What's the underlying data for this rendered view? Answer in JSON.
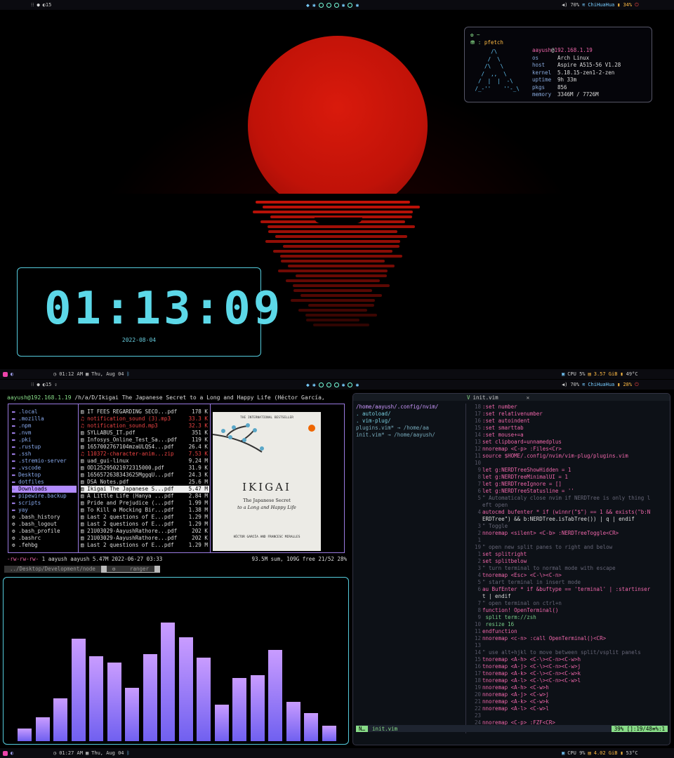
{
  "top_bar": {
    "workspace_count": "15",
    "volume": "70%",
    "wifi": "ChiHuaHua",
    "battery": "34%"
  },
  "pfetch": {
    "cmd_prompt": "~",
    "cmd": "pfetch",
    "user": "aayush",
    "host_ip": "192.168.1.19",
    "art": "      /\\\n     /  \\\n    /\\   \\\n   /  ,,  \\\n  /  |  |  -\\\n /_-''    ''-_\\",
    "rows": [
      {
        "k": "os",
        "v": "Arch Linux"
      },
      {
        "k": "host",
        "v": "Aspire A515-56 V1.28"
      },
      {
        "k": "kernel",
        "v": "5.18.15-zen1-2-zen"
      },
      {
        "k": "uptime",
        "v": "9h 33m"
      },
      {
        "k": "pkgs",
        "v": "856"
      },
      {
        "k": "memory",
        "v": "3346M / 7726M"
      }
    ]
  },
  "clock": {
    "time": "01:13:09",
    "date": "2022-08-04"
  },
  "mid_bar": {
    "time": "01:12 AM",
    "day": "Thu, Aug 04",
    "cpu": "CPU 5%",
    "mem": "3.57 GiB",
    "temp": "49°C",
    "workspace_count": "15",
    "volume": "70%",
    "wifi": "ChiHuaHua",
    "battery": "28%"
  },
  "ranger": {
    "title_user": "aayush@192.168.1.19",
    "title_path": " /h/a/D/Ikigai The Japanese Secret to a Long and Happy Life (Héctor García,",
    "dirs": [
      ".local",
      ".mozilla",
      ".npm",
      ".nvm",
      ".pki",
      ".rustup",
      ".ssh",
      ".stremio-server",
      ".vscode",
      "Desktop",
      "dotfiles",
      "Downloads",
      "pipewire.backup",
      "scripts",
      "yay",
      ".bash_history",
      ".bash_logout",
      ".bash_profile",
      ".bashrc",
      ".fehbg"
    ],
    "files": [
      {
        "n": "IT FEES REGARDING SECO...pdf",
        "s": "178 K",
        "c": ""
      },
      {
        "n": "notification_sound (3).mp3",
        "s": "33.3 K",
        "c": "red"
      },
      {
        "n": "notification_sound.mp3",
        "s": "32.3 K",
        "c": "red"
      },
      {
        "n": "SYLLABUS_IT.pdf",
        "s": "351 K",
        "c": ""
      },
      {
        "n": "Infosys_Online_Test_Sa...pdf",
        "s": "119 K",
        "c": ""
      },
      {
        "n": "1657002767104mzaULQS4...pdf",
        "s": "26.4 K",
        "c": ""
      },
      {
        "n": "110372-character-anim...zip",
        "s": "7.53 K",
        "c": "red"
      },
      {
        "n": "uad_gui-linux",
        "s": "9.24 M",
        "c": ""
      },
      {
        "n": "OD125295021972315000.pdf",
        "s": "31.9 K",
        "c": ""
      },
      {
        "n": "1656572638343625MggqU...pdf",
        "s": "24.3 K",
        "c": ""
      },
      {
        "n": "DSA Notes.pdf",
        "s": "25.6 M",
        "c": ""
      },
      {
        "n": "Ikigai The Japanese S...pdf",
        "s": "5.47 M",
        "c": "sel"
      },
      {
        "n": "A Little Life (Hanya ...pdf",
        "s": "2.84 M",
        "c": ""
      },
      {
        "n": "Pride and Prejudice (...pdf",
        "s": "1.99 M",
        "c": ""
      },
      {
        "n": "To Kill a Mocking Bir...pdf",
        "s": "1.38 M",
        "c": ""
      },
      {
        "n": "Last 2 questions of E...pdf",
        "s": "1.29 M",
        "c": ""
      },
      {
        "n": "Last 2 questions of E...pdf",
        "s": "1.29 M",
        "c": ""
      },
      {
        "n": "21U03029-AayushRathore...pdf",
        "s": "202 K",
        "c": ""
      },
      {
        "n": "21U03029-AayushRathore...pdf",
        "s": "202 K",
        "c": ""
      },
      {
        "n": "Last 2 questions of E...pdf",
        "s": "1.29 M",
        "c": ""
      }
    ],
    "book": {
      "top": "THE INTERNATIONAL BESTSELLER",
      "title": "IKIGAI",
      "sub1": "The Japanese Secret",
      "sub2": "to a Long and Happy Life",
      "authors": "HÉCTOR GARCÍA AND FRANCESC MIRALLES"
    },
    "status_perm": "-rw-rw-rw-",
    "status_info": " 1 aayush aayush 5.47M 2022-06-27 03:33",
    "status_right": "93.5M sum, 109G free  21/52  28%",
    "tab1": "../Desktop/Development/node",
    "tab2": "ranger"
  },
  "cava": {
    "levels": [
      0.08,
      0.15,
      0.27,
      0.65,
      0.54,
      0.5,
      0.34,
      0.55,
      0.75,
      0.66,
      0.53,
      0.23,
      0.4,
      0.42,
      0.58,
      0.25,
      0.18,
      0.1
    ]
  },
  "vim": {
    "tab": "init.vim",
    "tree": [
      {
        "t": "/home/aayush/.config/nvim/",
        "c": ""
      },
      {
        "t": ".  autoload/",
        "c": ""
      },
      {
        "t": ".  vim-plug/",
        "c": ""
      },
      {
        "t": "    plugins.vim* → /home/aa",
        "c": "y"
      },
      {
        "t": "  init.vim* → /home/aayush/",
        "c": "y"
      }
    ],
    "lines": [
      {
        "n": "18",
        "t": ":set number",
        "k": "kw"
      },
      {
        "n": "17",
        "t": ":set relativenumber",
        "k": "kw"
      },
      {
        "n": "16",
        "t": ":set autoindent",
        "k": "kw"
      },
      {
        "n": "15",
        "t": ":set smarttab",
        "k": "kw"
      },
      {
        "n": "14",
        "t": ":set mouse+=a",
        "k": "kw"
      },
      {
        "n": "13",
        "t": "set clipboard=unnamedplus",
        "k": "kw"
      },
      {
        "n": "12",
        "t": "nnoremap <C-p> :Files<Cr>",
        "k": "kw"
      },
      {
        "n": "11",
        "t": "source $HOME/.config/nvim/vim-plug/plugins.vim",
        "k": "kw"
      },
      {
        "n": "10",
        "t": "",
        "k": ""
      },
      {
        "n": "9",
        "t": "let g:NERDTreeShowHidden = 1",
        "k": "kw"
      },
      {
        "n": "8",
        "t": "let g:NERDTreeMinimalUI = 1",
        "k": "kw"
      },
      {
        "n": "7",
        "t": "let g:NERDTreeIgnore = []",
        "k": "kw"
      },
      {
        "n": "6",
        "t": "let g:NERDTreeStatusline = ''",
        "k": "kw"
      },
      {
        "n": "5",
        "t": "\" Automaticaly close nvim if NERDTree is only thing l",
        "k": "cm"
      },
      {
        "n": "",
        "t": "eft open",
        "k": "cm"
      },
      {
        "n": "4",
        "t": "autocmd bufenter * if (winnr(\"$\") == 1 && exists(\"b:N",
        "k": "kw"
      },
      {
        "n": "",
        "t": "ERDTree\") && b:NERDTree.isTabTree()) | q | endif",
        "k": ""
      },
      {
        "n": "3",
        "t": "\" Toggle",
        "k": "cm"
      },
      {
        "n": "2",
        "t": "nnoremap <silent> <C-b> :NERDTreeToggle<CR>",
        "k": "kw"
      },
      {
        "n": "1",
        "t": "",
        "k": ""
      },
      {
        "n": "19",
        "t": "\" open new split panes to right and below",
        "k": "cm"
      },
      {
        "n": "1",
        "t": "set splitright",
        "k": "kw"
      },
      {
        "n": "2",
        "t": "set splitbelow",
        "k": "kw"
      },
      {
        "n": "3",
        "t": "\" turn terminal to normal mode with escape",
        "k": "cm"
      },
      {
        "n": "4",
        "t": "tnoremap <Esc> <C-\\><C-n>",
        "k": "kw"
      },
      {
        "n": "5",
        "t": "\" start terminal in insert mode",
        "k": "cm"
      },
      {
        "n": "6",
        "t": "au BufEnter * if &buftype == 'terminal' | :startinser",
        "k": "kw"
      },
      {
        "n": "",
        "t": "t | endif",
        "k": ""
      },
      {
        "n": "7",
        "t": "\" open terminal on ctrl+n",
        "k": "cm"
      },
      {
        "n": "8",
        "t": "function! OpenTerminal()",
        "k": "kw"
      },
      {
        "n": "9",
        "t": "  split term://zsh",
        "k": "st"
      },
      {
        "n": "10",
        "t": "  resize 16",
        "k": "st"
      },
      {
        "n": "11",
        "t": "endfunction",
        "k": "kw"
      },
      {
        "n": "12",
        "t": "nnoremap <c-n> :call OpenTerminal()<CR>",
        "k": "kw"
      },
      {
        "n": "13",
        "t": "",
        "k": ""
      },
      {
        "n": "14",
        "t": "\" use alt+hjkl to move between split/vsplit panels",
        "k": "cm"
      },
      {
        "n": "15",
        "t": "tnoremap <A-h> <C-\\><C-n><C-w>h",
        "k": "kw"
      },
      {
        "n": "16",
        "t": "tnoremap <A-j> <C-\\><C-n><C-w>j",
        "k": "kw"
      },
      {
        "n": "17",
        "t": "tnoremap <A-k> <C-\\><C-n><C-w>k",
        "k": "kw"
      },
      {
        "n": "18",
        "t": "tnoremap <A-l> <C-\\><C-n><C-w>l",
        "k": "kw"
      },
      {
        "n": "19",
        "t": "nnoremap <A-h> <C-w>h",
        "k": "kw"
      },
      {
        "n": "20",
        "t": "nnoremap <A-j> <C-w>j",
        "k": "kw"
      },
      {
        "n": "21",
        "t": "nnoremap <A-k> <C-w>k",
        "k": "kw"
      },
      {
        "n": "22",
        "t": "nnoremap <A-l> <C-w>l",
        "k": "kw"
      },
      {
        "n": "23",
        "t": "",
        "k": ""
      },
      {
        "n": "24",
        "t": "nnoremap <C-p> :FZF<CR>",
        "k": "kw"
      }
    ],
    "status_mode": "N…",
    "status_file": "init.vim",
    "status_right": "39%  []:19/48≡%:1"
  },
  "bottom_bar": {
    "time": "01:27 AM",
    "day": "Thu, Aug 04",
    "cpu": "CPU 9%",
    "mem": "4.02 GiB",
    "temp": "53°C"
  }
}
